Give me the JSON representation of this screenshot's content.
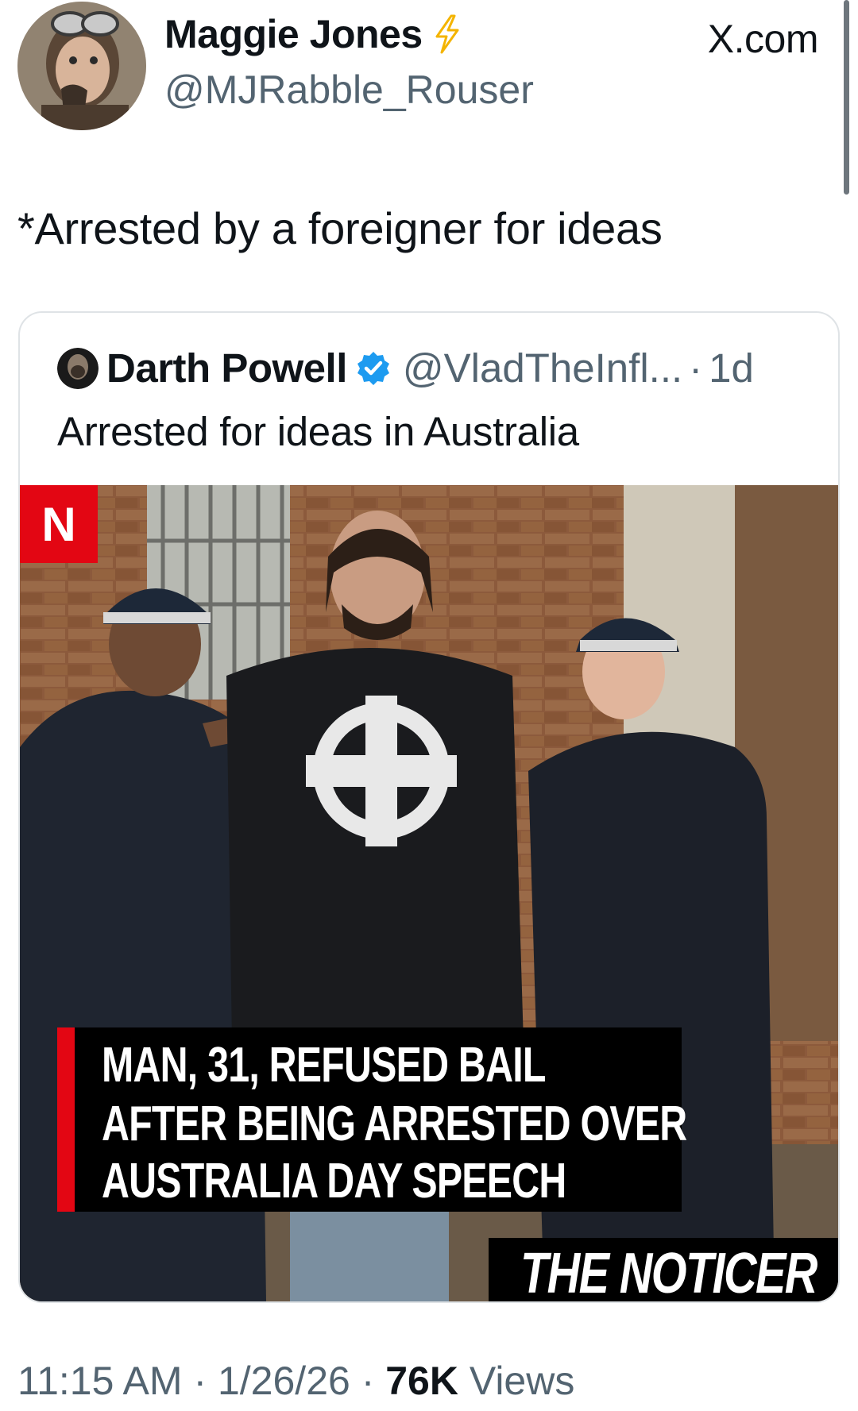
{
  "author": {
    "display_name": "Maggie Jones",
    "handle": "@MJRabble_Rouser",
    "badge_icon": "lightning-bolt-icon",
    "badge_color": "#f4b400"
  },
  "site_label": "X.com",
  "tweet": {
    "text": "*Arrested by a foreigner for ideas"
  },
  "quoted_tweet": {
    "display_name": "Darth Powell",
    "verified_icon": "verified-badge-icon",
    "verified_color": "#1d9bf0",
    "handle": "@VladTheInfl...",
    "separator": "·",
    "time": "1d",
    "text": "Arrested for ideas in Australia",
    "media": {
      "logo_letter": "N",
      "headline_lines": [
        "MAN, 31, REFUSED BAIL",
        "AFTER BEING ARRESTED OVER",
        "AUSTRALIA DAY SPEECH"
      ],
      "brand": "THE NOTICER"
    }
  },
  "meta": {
    "time": "11:15 AM",
    "sep1": " · ",
    "date": "1/26/26",
    "sep2": " · ",
    "views_count": "76K",
    "views_label": " Views"
  }
}
